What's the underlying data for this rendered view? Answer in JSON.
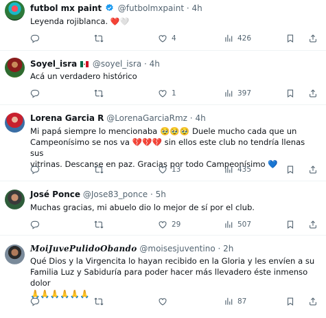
{
  "tweets": [
    {
      "name": "futbol mx paint",
      "handle": "@futbolmxpaint",
      "dot": "·",
      "time": "4h",
      "text": "Leyenda rojiblanca.",
      "text_suffix": "❤️🤍",
      "replies": "",
      "retweets": "",
      "likes": "4",
      "views": "426"
    },
    {
      "name": "Soyel_isra",
      "handle": "@soyel_isra",
      "dot": "·",
      "time": "4h",
      "text": "Acá un verdadero histórico",
      "replies": "",
      "retweets": "",
      "likes": "1",
      "views": "397"
    },
    {
      "name": "Lorena Garcia R",
      "handle": "@LorenaGarciaRmz",
      "dot": "·",
      "time": "4h",
      "line1": "Mi papá siempre lo mencionaba 🥹🥹🥹 Duele mucho cada que un",
      "line2": "Campeonísimo se nos va 💔💔💔 sin ellos este club no tendría llenas sus",
      "line3": "vitrinas. Descanse en paz. Gracias por todo Campeonísimo 💙",
      "replies": "",
      "retweets": "",
      "likes": "13",
      "views": "435"
    },
    {
      "name": "José Ponce",
      "handle": "@Jose83_ponce",
      "dot": "·",
      "time": "5h",
      "text": "Muchas gracias, mi abuelo dio lo mejor de sí por el club.",
      "replies": "",
      "retweets": "",
      "likes": "29",
      "views": "507"
    },
    {
      "name": "𝑴𝒐𝒊𝑱𝒖𝒗𝒆𝑷𝒖𝒍𝒊𝒅𝒐𝑶𝒃𝒂𝒏𝒅𝒐",
      "handle": "@moisesjuventino",
      "dot": "·",
      "time": "2h",
      "line1": "Qué Dios y la Virgencita lo hayan recibido en la Gloria y les envíen a su",
      "line2": "Familia Luz y Sabiduría para poder hacer más llevadero éste inmenso dolor",
      "line3": "🙏🙏🙏🙏🙏🙏",
      "replies": "",
      "retweets": "",
      "likes": "",
      "views": "87"
    }
  ],
  "icons": {
    "reply": "reply-icon",
    "retweet": "retweet-icon",
    "like": "like-icon",
    "views": "views-icon",
    "bookmark": "bookmark-icon",
    "share": "share-icon",
    "verified": "verified-badge-icon"
  },
  "colors": {
    "text_primary": "#0f1419",
    "text_secondary": "#536471",
    "verified_blue": "#1d9bf0",
    "divider": "#eff3f4"
  }
}
